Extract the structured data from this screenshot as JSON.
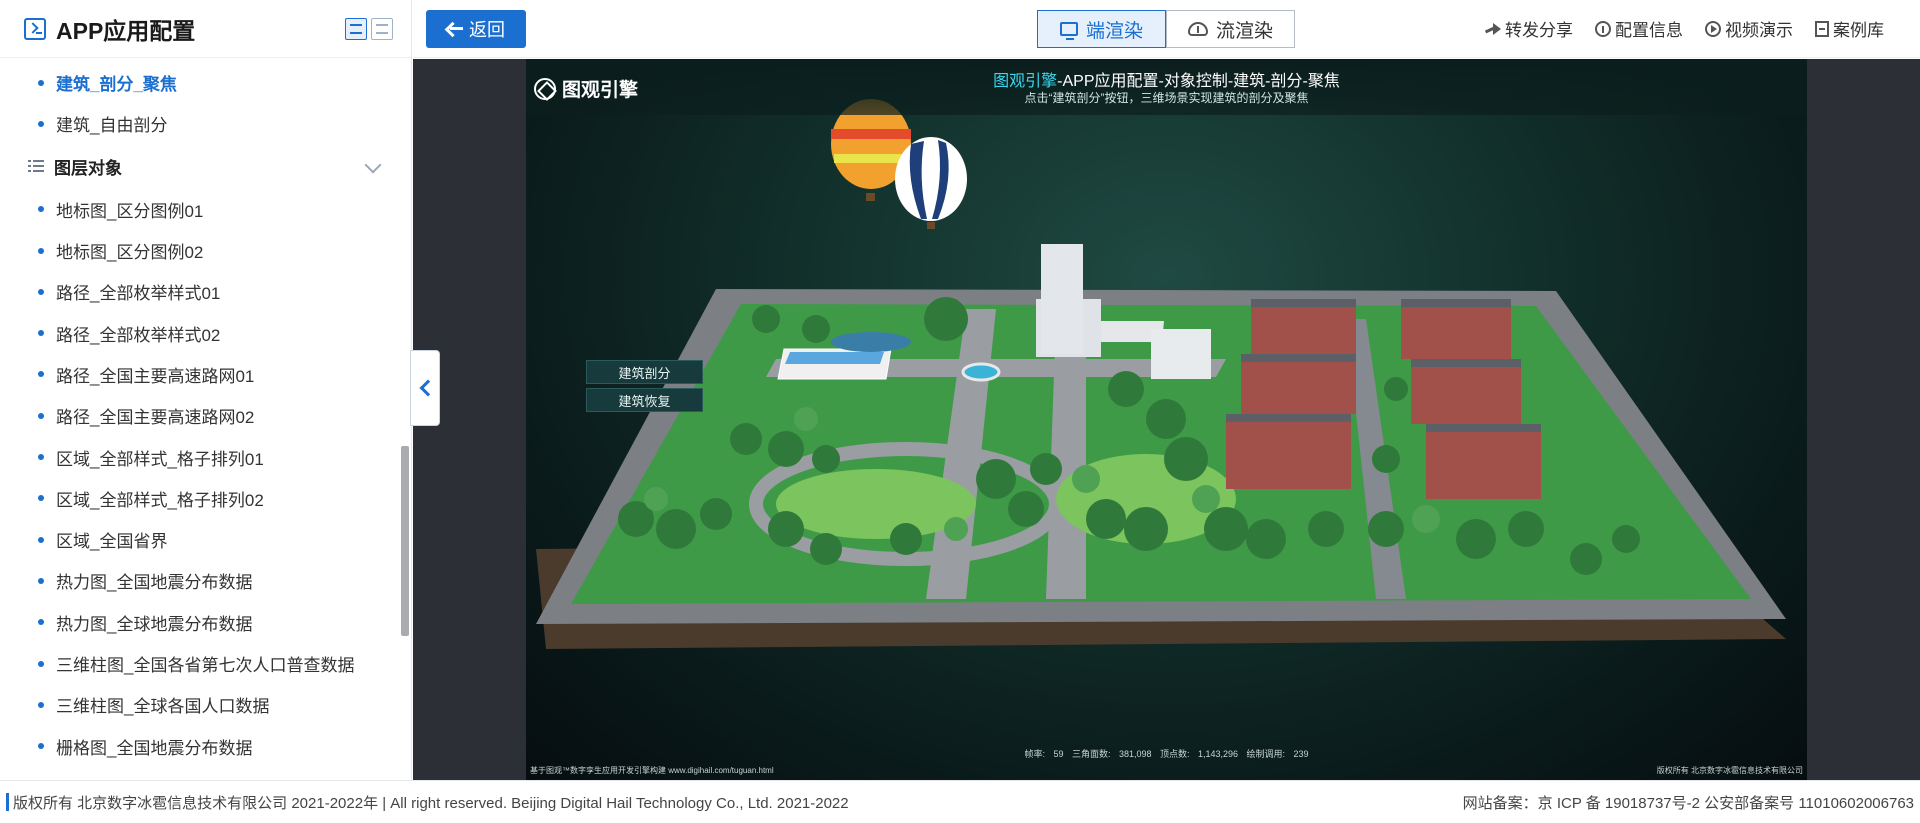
{
  "sidebar": {
    "title": "APP应用配置",
    "items_top": [
      {
        "label": "建筑_剖分_聚焦",
        "active": true
      },
      {
        "label": "建筑_自由剖分",
        "active": false
      }
    ],
    "group": {
      "label": "图层对象"
    },
    "items": [
      "地标图_区分图例01",
      "地标图_区分图例02",
      "路径_全部枚举样式01",
      "路径_全部枚举样式02",
      "路径_全国主要高速路网01",
      "路径_全国主要高速路网02",
      "区域_全部样式_格子排列01",
      "区域_全部样式_格子排列02",
      "区域_全国省界",
      "热力图_全国地震分布数据",
      "热力图_全球地震分布数据",
      "三维柱图_全国各省第七次人口普查数据",
      "三维柱图_全球各国人口数据",
      "栅格图_全国地震分布数据"
    ]
  },
  "topbar": {
    "back_label": "返回",
    "render_tabs": [
      {
        "label": "端渲染",
        "active": true
      },
      {
        "label": "流渲染",
        "active": false
      }
    ],
    "links": {
      "share": "转发分享",
      "config": "配置信息",
      "video": "视频演示",
      "library": "案例库"
    }
  },
  "viewport": {
    "brand": "图观引擎",
    "title_highlight": "图观引擎",
    "title_rest": "-APP应用配置-对象控制-建筑-剖分-聚焦",
    "subtitle": "点击“建筑剖分”按钮，三维场景实现建筑的剖分及聚焦",
    "btn_split": "建筑剖分",
    "btn_restore": "建筑恢复",
    "stats": "帧率: 59   三角面数: 381,098   顶点数: 1,143,296   绘制调用: 239",
    "foot_left": "基于图观™数字孪生应用开发引擎构建 www.digihail.com/tuguan.html",
    "foot_right": "版权所有 北京数字冰雹信息技术有限公司"
  },
  "footer": {
    "left": "版权所有 北京数字冰雹信息技术有限公司 2021-2022年 | All right reserved. Beijing Digital Hail Technology Co., Ltd. 2021-2022",
    "right": "网站备案：京 ICP 备 19018737号-2 公安部备案号 11010602006763"
  },
  "colors": {
    "accent": "#1a6fd1",
    "title_highlight": "#39d7f0",
    "scene_bg": "#0a1a1a"
  }
}
